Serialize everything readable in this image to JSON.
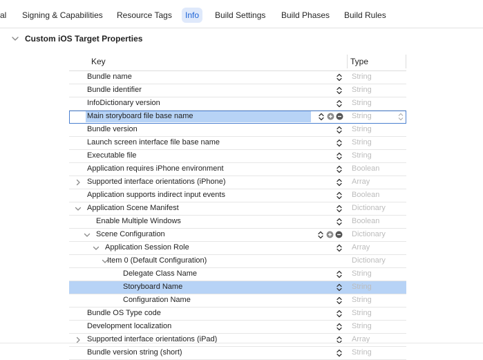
{
  "tabs": [
    {
      "label": "al",
      "active": false
    },
    {
      "label": "Signing & Capabilities",
      "active": false
    },
    {
      "label": "Resource Tags",
      "active": false
    },
    {
      "label": "Info",
      "active": true
    },
    {
      "label": "Build Settings",
      "active": false
    },
    {
      "label": "Build Phases",
      "active": false
    },
    {
      "label": "Build Rules",
      "active": false
    }
  ],
  "section": {
    "title": "Custom iOS Target Properties"
  },
  "columns": {
    "key": "Key",
    "type": "Type"
  },
  "rows": [
    {
      "key": "Bundle name",
      "type": "String"
    },
    {
      "key": "Bundle identifier",
      "type": "String"
    },
    {
      "key": "InfoDictionary version",
      "type": "String"
    },
    {
      "key": "Main storyboard file base name",
      "type": "String"
    },
    {
      "key": "Bundle version",
      "type": "String"
    },
    {
      "key": "Launch screen interface file base name",
      "type": "String"
    },
    {
      "key": "Executable file",
      "type": "String"
    },
    {
      "key": "Application requires iPhone environment",
      "type": "Boolean"
    },
    {
      "key": "Supported interface orientations (iPhone)",
      "type": "Array"
    },
    {
      "key": "Application supports indirect input events",
      "type": "Boolean"
    },
    {
      "key": "Application Scene Manifest",
      "type": "Dictionary"
    },
    {
      "key": "Enable Multiple Windows",
      "type": "Boolean"
    },
    {
      "key": "Scene Configuration",
      "type": "Dictionary"
    },
    {
      "key": "Application Session Role",
      "type": "Array"
    },
    {
      "key": "Item 0 (Default Configuration)",
      "type": "Dictionary"
    },
    {
      "key": "Delegate Class Name",
      "type": "String"
    },
    {
      "key": "Storyboard Name",
      "type": "String"
    },
    {
      "key": "Configuration Name",
      "type": "String"
    },
    {
      "key": "Bundle OS Type code",
      "type": "String"
    },
    {
      "key": "Development localization",
      "type": "String"
    },
    {
      "key": "Supported interface orientations (iPad)",
      "type": "Array"
    },
    {
      "key": "Bundle version string (short)",
      "type": "String"
    }
  ],
  "icons": {
    "disclosure": "chevron-icon",
    "stepper": "stepper-updown-icon",
    "add": "plus-circle-icon",
    "remove": "minus-circle-icon"
  },
  "colors": {
    "accent": "#1d63d6",
    "selection": "#b7d3f6",
    "tab_active_bg": "#dfe9fb"
  }
}
